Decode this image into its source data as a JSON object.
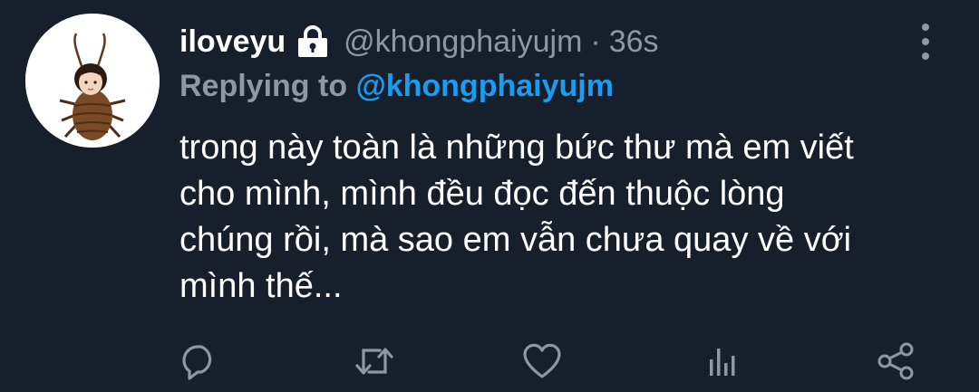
{
  "tweet": {
    "display_name": "iloveyu",
    "handle": "@khongphaiyujm",
    "separator": "·",
    "timestamp": "36s",
    "reply_prefix": "Replying to",
    "reply_mention": "@khongphaiyujm",
    "body_lines": [
      "trong này toàn là những bức thư mà em viết",
      "cho mình, mình đều đọc đến thuộc lòng",
      "chúng rồi, mà sao em vẫn chưa quay về với",
      "mình thế..."
    ]
  },
  "icons": {
    "avatar": "profile-picture",
    "lock": "lock-icon",
    "more": "more-vertical-icon",
    "reply": "comment-icon",
    "retweet": "retweet-icon",
    "like": "heart-icon",
    "analytics": "analytics-icon",
    "share": "share-icon"
  },
  "colors": {
    "background": "#16202c",
    "text": "#ffffff",
    "muted": "#8b98a5",
    "accent": "#1d9bf0"
  }
}
